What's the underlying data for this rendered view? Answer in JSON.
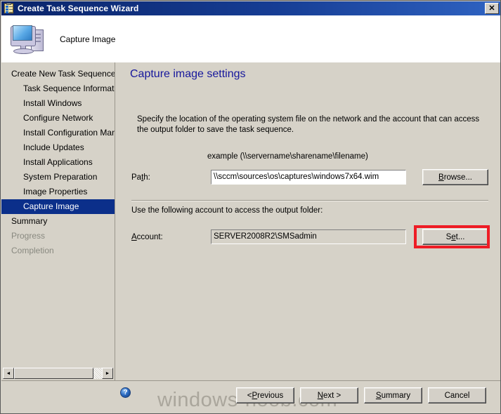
{
  "window": {
    "title": "Create Task Sequence Wizard",
    "title_icon": "task-sequence-clipboard-icon",
    "close_label": "✕"
  },
  "header": {
    "icon": "computer-icon",
    "title": "Capture Image"
  },
  "sidebar": {
    "items": [
      {
        "label": "Create New Task Sequence",
        "indent": false,
        "state": "normal"
      },
      {
        "label": "Task Sequence Information",
        "indent": true,
        "state": "normal"
      },
      {
        "label": "Install Windows",
        "indent": true,
        "state": "normal"
      },
      {
        "label": "Configure Network",
        "indent": true,
        "state": "normal"
      },
      {
        "label": "Install Configuration Manag",
        "indent": true,
        "state": "normal"
      },
      {
        "label": "Include Updates",
        "indent": true,
        "state": "normal"
      },
      {
        "label": "Install Applications",
        "indent": true,
        "state": "normal"
      },
      {
        "label": "System Preparation",
        "indent": true,
        "state": "normal"
      },
      {
        "label": "Image Properties",
        "indent": true,
        "state": "normal"
      },
      {
        "label": "Capture Image",
        "indent": true,
        "state": "selected"
      },
      {
        "label": "Summary",
        "indent": false,
        "state": "normal"
      },
      {
        "label": "Progress",
        "indent": false,
        "state": "disabled"
      },
      {
        "label": "Completion",
        "indent": false,
        "state": "disabled"
      }
    ],
    "scrollbar": {
      "left_arrow": "◄",
      "right_arrow": "►"
    }
  },
  "main": {
    "page_title": "Capture image settings",
    "intro": "Specify the location of the operating system file on the network and the account that can access the output folder to save the task sequence.",
    "example_line": "example (\\\\servername\\sharename\\filename)",
    "path": {
      "label_pre": "Pa",
      "label_accel": "t",
      "label_post": "h:",
      "value": "\\\\sccm\\sources\\os\\captures\\windows7x64.wim",
      "placeholder": "",
      "browse_pre": "",
      "browse_accel": "B",
      "browse_post": "rowse..."
    },
    "account": {
      "caption": "Use the following account to access the output folder:",
      "label_pre": "",
      "label_accel": "A",
      "label_post": "ccount:",
      "value": "SERVER2008R2\\SMSadmin",
      "set_pre": "S",
      "set_accel": "e",
      "set_post": "t..."
    },
    "highlight_color": "#ee1c25"
  },
  "footer": {
    "help_icon": "help-question-icon",
    "help_label": "?",
    "watermark": "windows-noob.com",
    "buttons": [
      {
        "pre": "< ",
        "accel": "P",
        "post": "revious"
      },
      {
        "pre": "",
        "accel": "N",
        "post": "ext >"
      },
      {
        "pre": "",
        "accel": "S",
        "post": "ummary"
      },
      {
        "pre": "Cancel",
        "accel": "",
        "post": ""
      }
    ]
  }
}
